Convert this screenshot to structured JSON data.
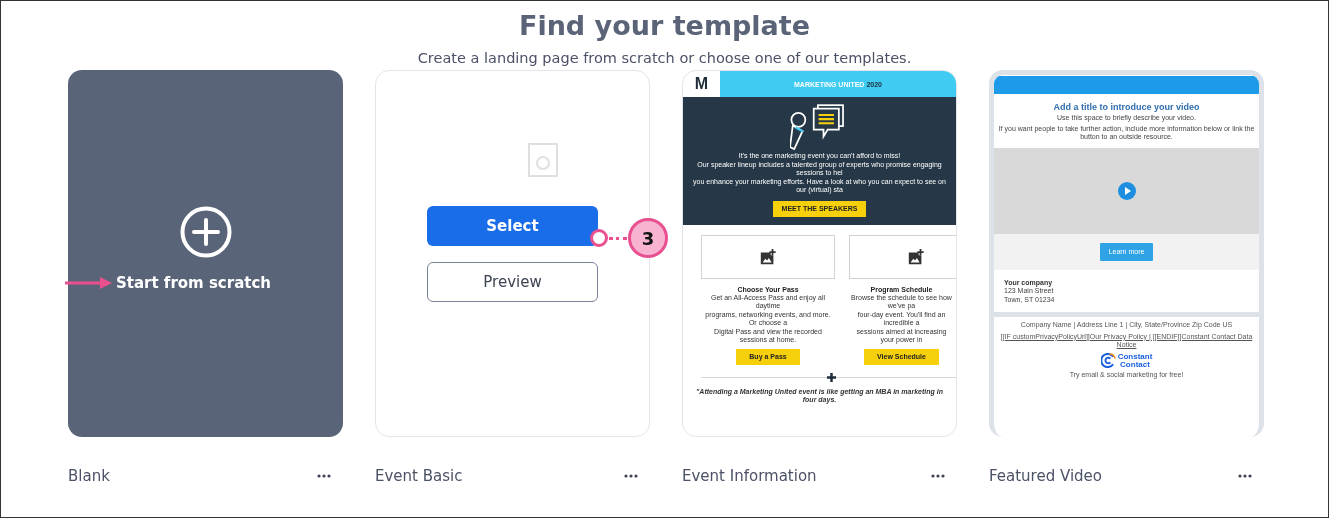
{
  "heading": "Find your template",
  "subheading": "Create a landing page from scratch or choose one of our templates.",
  "templates": [
    {
      "kind": "blank",
      "name": "Blank",
      "action": "Start from scratch"
    },
    {
      "kind": "hover",
      "name": "Event Basic",
      "buttons": [
        "Select",
        "Preview"
      ],
      "callout": "3"
    },
    {
      "kind": "event",
      "name": "Event Information",
      "preview": {
        "logo": "M",
        "banner": "MARKETING UNITED",
        "banner_year": "2020",
        "intro": [
          "It's the one marketing event you can't afford to miss!",
          "Our speaker lineup includes a talented group of experts who promise engaging sessions to hel",
          "you enhance your marketing efforts. Have a look at who you can expect to see on our (virtual) sta"
        ],
        "cta": "MEET THE SPEAKERS",
        "columns": [
          {
            "title": "Choose Your Pass",
            "lines": [
              "Get an All-Access Pass and enjoy all daytime",
              "programs, networking events, and more. Or choose a",
              "Digital Pass and view the recorded sessions at home."
            ],
            "button": "Buy a Pass"
          },
          {
            "title": "Program Schedule",
            "lines": [
              "Browse the schedule to see how we've pa",
              "four-day event. You'll find an incredible a",
              "sessions aimed at increasing your power in"
            ],
            "button": "View Schedule"
          }
        ],
        "quote": "\"Attending a Marketing United event is like getting an MBA in marketing in four days."
      }
    },
    {
      "kind": "video",
      "name": "Featured Video",
      "preview": {
        "title": "Add a title to introduce your video",
        "description": [
          "Use this space to briefly describe your video.",
          "If you want people to take further action, include more information below or link the button to an outside resource."
        ],
        "button": "Learn more",
        "company": "Your company",
        "address": [
          "123 Main Street",
          "Town, ST 01234"
        ],
        "footer_address": "Company Name | Address Line 1 | City, State/Province Zip Code US",
        "footer_links": "[[IF customPrivacyPolicyUrl]]Our Privacy Policy | [[ENDIF]]Constant Contact Data Notice",
        "brand": [
          "Constant",
          "Contact"
        ],
        "tagline": "Try email & social marketing for free!"
      }
    }
  ]
}
